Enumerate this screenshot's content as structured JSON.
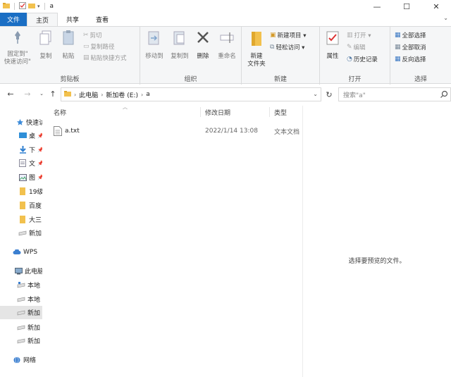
{
  "window": {
    "title": "a",
    "minimize": "—",
    "maximize": "☐",
    "close": "✕"
  },
  "tabs": [
    "文件",
    "主页",
    "共享",
    "查看"
  ],
  "ribbon": {
    "clipboard": {
      "label": "剪贴板",
      "pin_line1": "固定到\"",
      "pin_line2": "快速访问\"",
      "copy": "复制",
      "paste": "粘贴",
      "cut": "剪切",
      "copy_path": "复制路径",
      "paste_shortcut": "粘贴快捷方式"
    },
    "organize": {
      "label": "组织",
      "move_to": "移动到",
      "copy_to": "复制到",
      "delete": "删除",
      "rename": "重命名"
    },
    "new": {
      "label": "新建",
      "new_folder_line1": "新建",
      "new_folder_line2": "文件夹",
      "new_item": "新建项目 ▾",
      "easy_access": "轻松访问 ▾"
    },
    "open": {
      "label": "打开",
      "properties": "属性",
      "open": "打开 ▾",
      "edit": "编辑",
      "history": "历史记录"
    },
    "select": {
      "label": "选择",
      "select_all": "全部选择",
      "select_none": "全部取消",
      "invert": "反向选择"
    }
  },
  "address": {
    "crumbs": [
      "此电脑",
      "新加卷 (E:)",
      "a"
    ],
    "search_placeholder": "搜索\"a\""
  },
  "nav": [
    {
      "label": "快速访",
      "icon": "star-icon"
    },
    {
      "label": "桌",
      "icon": "desktop-icon"
    },
    {
      "label": "下",
      "icon": "download-icon"
    },
    {
      "label": "文",
      "icon": "document-icon"
    },
    {
      "label": "图",
      "icon": "picture-icon"
    },
    {
      "label": "19级",
      "icon": "folder-icon"
    },
    {
      "label": "百度",
      "icon": "folder-icon"
    },
    {
      "label": "大三",
      "icon": "folder-icon"
    },
    {
      "label": "新加",
      "icon": "drive-icon"
    },
    {
      "label": "WPS",
      "icon": "cloud-icon"
    },
    {
      "label": "此电脑",
      "icon": "pc-icon"
    },
    {
      "label": "本地",
      "icon": "drive-icon"
    },
    {
      "label": "本地",
      "icon": "drive-icon"
    },
    {
      "label": "新加",
      "icon": "drive-icon"
    },
    {
      "label": "新加",
      "icon": "drive-icon"
    },
    {
      "label": "新加",
      "icon": "drive-icon"
    },
    {
      "label": "网络",
      "icon": "network-icon"
    }
  ],
  "columns": {
    "name": "名称",
    "date": "修改日期",
    "type": "类型"
  },
  "files": [
    {
      "name": "a.txt",
      "date": "2022/1/14 13:08",
      "type": "文本文档"
    }
  ],
  "preview": {
    "message": "选择要预览的文件。"
  },
  "colors": {
    "file_tab": "#1a6ec4",
    "ribbon_bg": "#f5f6f7",
    "folder": "#f2c14e",
    "selection": "#e5e5e5"
  }
}
